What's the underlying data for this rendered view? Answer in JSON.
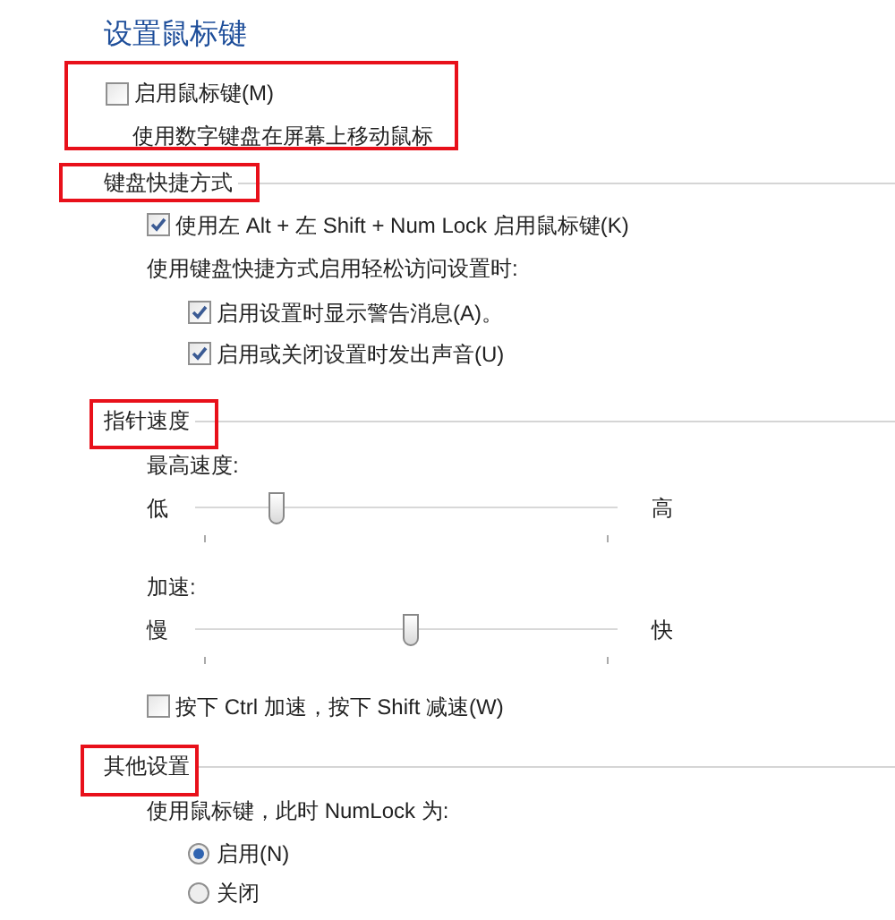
{
  "title": "设置鼠标键",
  "enable": {
    "label": "启用鼠标键(M)",
    "checked": false,
    "description": "使用数字键盘在屏幕上移动鼠标",
    "highlighted": true
  },
  "sections": [
    {
      "title": "键盘快捷方式",
      "highlighted": true,
      "items": [
        {
          "kind": "checkbox",
          "label": "使用左 Alt + 左 Shift + Num Lock 启用鼠标键(K)",
          "checked": true
        },
        {
          "kind": "text",
          "label": "使用键盘快捷方式启用轻松访问设置时:"
        },
        {
          "kind": "checkbox",
          "label": "启用设置时显示警告消息(A)。",
          "checked": true,
          "indent": true
        },
        {
          "kind": "checkbox",
          "label": "启用或关闭设置时发出声音(U)",
          "checked": true,
          "indent": true
        }
      ]
    },
    {
      "title": "指针速度",
      "highlighted": true,
      "items": [
        {
          "kind": "text",
          "label": "最高速度:"
        },
        {
          "kind": "slider",
          "min_label": "低",
          "max_label": "高",
          "level": 0.19
        },
        {
          "kind": "text",
          "label": "加速:"
        },
        {
          "kind": "slider",
          "min_label": "慢",
          "max_label": "快",
          "level": 0.51
        },
        {
          "kind": "checkbox",
          "label": "按下 Ctrl 加速，按下 Shift 减速(W)",
          "checked": false
        }
      ]
    },
    {
      "title": "其他设置",
      "highlighted": true,
      "items": [
        {
          "kind": "text",
          "label": "使用鼠标键，此时 NumLock 为:"
        },
        {
          "kind": "radio",
          "label": "启用(N)",
          "selected": true,
          "indent": true
        },
        {
          "kind": "radio",
          "label": "关闭",
          "selected": false,
          "indent": true
        }
      ]
    }
  ]
}
